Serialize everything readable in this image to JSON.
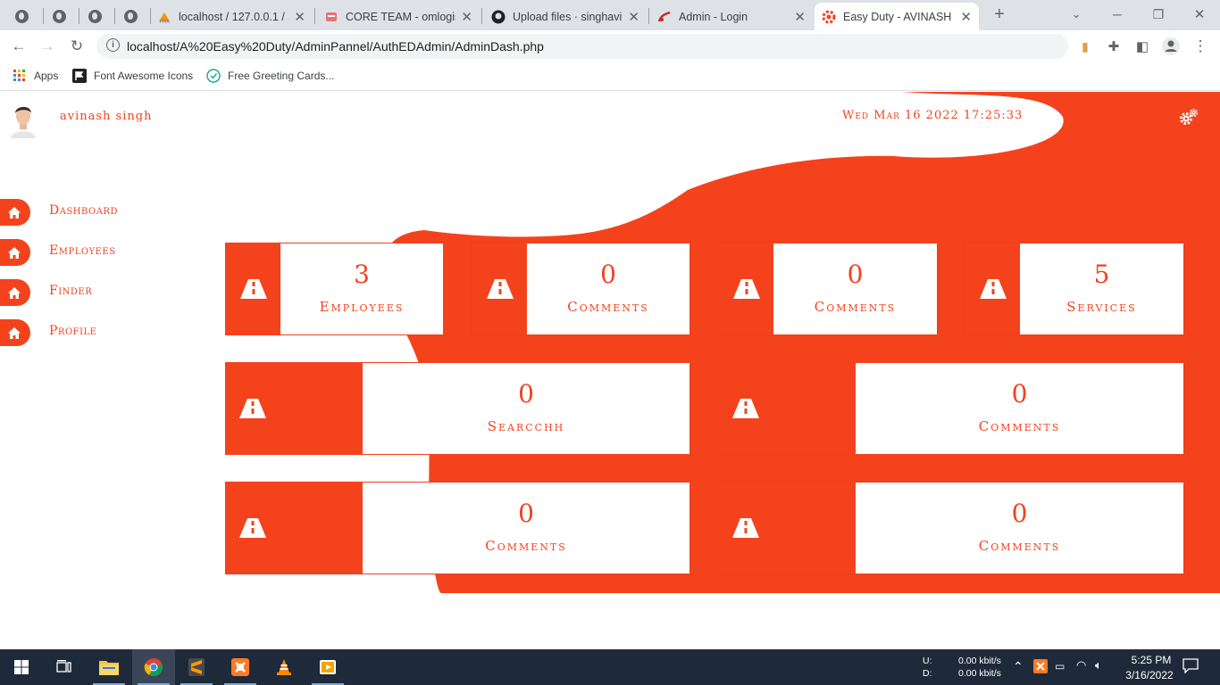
{
  "browser": {
    "tabs": [
      {
        "title": "",
        "icon": "globe-icon"
      },
      {
        "title": "",
        "icon": "globe-icon"
      },
      {
        "title": "",
        "icon": "globe-icon"
      },
      {
        "title": "",
        "icon": "globe-icon"
      },
      {
        "title": "localhost / 127.0.0.1 / a",
        "icon": "phpmyadmin-icon"
      },
      {
        "title": "CORE TEAM - omlogist",
        "icon": "app-icon"
      },
      {
        "title": "Upload files · singhavi9",
        "icon": "github-icon"
      },
      {
        "title": "Admin - Login",
        "icon": "admin-icon"
      },
      {
        "title": "Easy Duty - AVINASH S",
        "icon": "gear-icon"
      }
    ],
    "url": "localhost/A%20Easy%20Duty/AdminPannel/AuthEDAdmin/AdminDash.php",
    "bookmarks": [
      "Apps",
      "Font Awesome Icons",
      "Free Greeting Cards..."
    ]
  },
  "header": {
    "username": "avinash singh",
    "datetime": "Wed Mar 16 2022 17:25:33"
  },
  "nav": [
    {
      "label": "Dashboard"
    },
    {
      "label": "Employees"
    },
    {
      "label": "Finder"
    },
    {
      "label": "Profile"
    }
  ],
  "cards": [
    {
      "value": "3",
      "label": "Employees"
    },
    {
      "value": "0",
      "label": "Comments"
    },
    {
      "value": "0",
      "label": "Comments"
    },
    {
      "value": "5",
      "label": "Services"
    },
    {
      "value": "0",
      "label": "Searcchh"
    },
    {
      "value": "0",
      "label": "Comments"
    },
    {
      "value": "0",
      "label": "Comments"
    },
    {
      "value": "0",
      "label": "Comments"
    }
  ],
  "taskbar": {
    "net_up_label": "U:",
    "net_down_label": "D:",
    "net_up": "0.00 kbit/s",
    "net_down": "0.00 kbit/s",
    "time": "5:25 PM",
    "date": "3/16/2022"
  },
  "colors": {
    "accent": "#f4421d",
    "taskbar": "#1e2a3a"
  }
}
